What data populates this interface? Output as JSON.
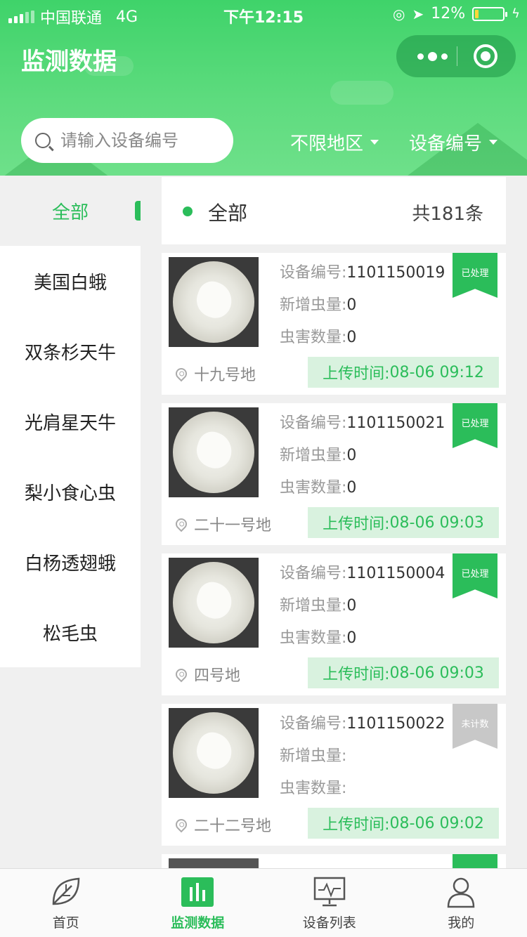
{
  "status_bar": {
    "carrier": "中国联通",
    "network": "4G",
    "time": "下午12:15",
    "battery": "12%",
    "battery_level": 0.12
  },
  "header": {
    "title": "监测数据",
    "search_placeholder": "请输入设备编号",
    "filter_region": "不限地区",
    "filter_device": "设备编号"
  },
  "sidebar": {
    "active": "全部",
    "items": [
      "美国白蛾",
      "双条杉天牛",
      "光肩星天牛",
      "梨小食心虫",
      "白杨透翅蛾",
      "松毛虫"
    ]
  },
  "summary": {
    "label": "全部",
    "count": "共181条"
  },
  "labels": {
    "device_no": "设备编号:",
    "new_pests": "新增虫量:",
    "pest_count": "虫害数量:",
    "upload_time": "上传时间:"
  },
  "cards": [
    {
      "device": "1101150019",
      "new": "0",
      "count": "0",
      "status": "已处理",
      "location": "十九号地",
      "time": "08-06 09:12"
    },
    {
      "device": "1101150021",
      "new": "0",
      "count": "0",
      "status": "已处理",
      "location": "二十一号地",
      "time": "08-06 09:03"
    },
    {
      "device": "1101150004",
      "new": "0",
      "count": "0",
      "status": "已处理",
      "location": "四号地",
      "time": "08-06 09:03"
    },
    {
      "device": "1101150022",
      "new": "",
      "count": "",
      "status": "未计数",
      "location": "二十二号地",
      "time": "08-06 09:02"
    }
  ],
  "tabbar": {
    "items": [
      "首页",
      "监测数据",
      "设备列表",
      "我的"
    ],
    "active_index": 1
  },
  "colors": {
    "brand": "#2bbd5a",
    "badge_pending": "#c8c8c8",
    "upload_bg": "#d9f2df"
  }
}
